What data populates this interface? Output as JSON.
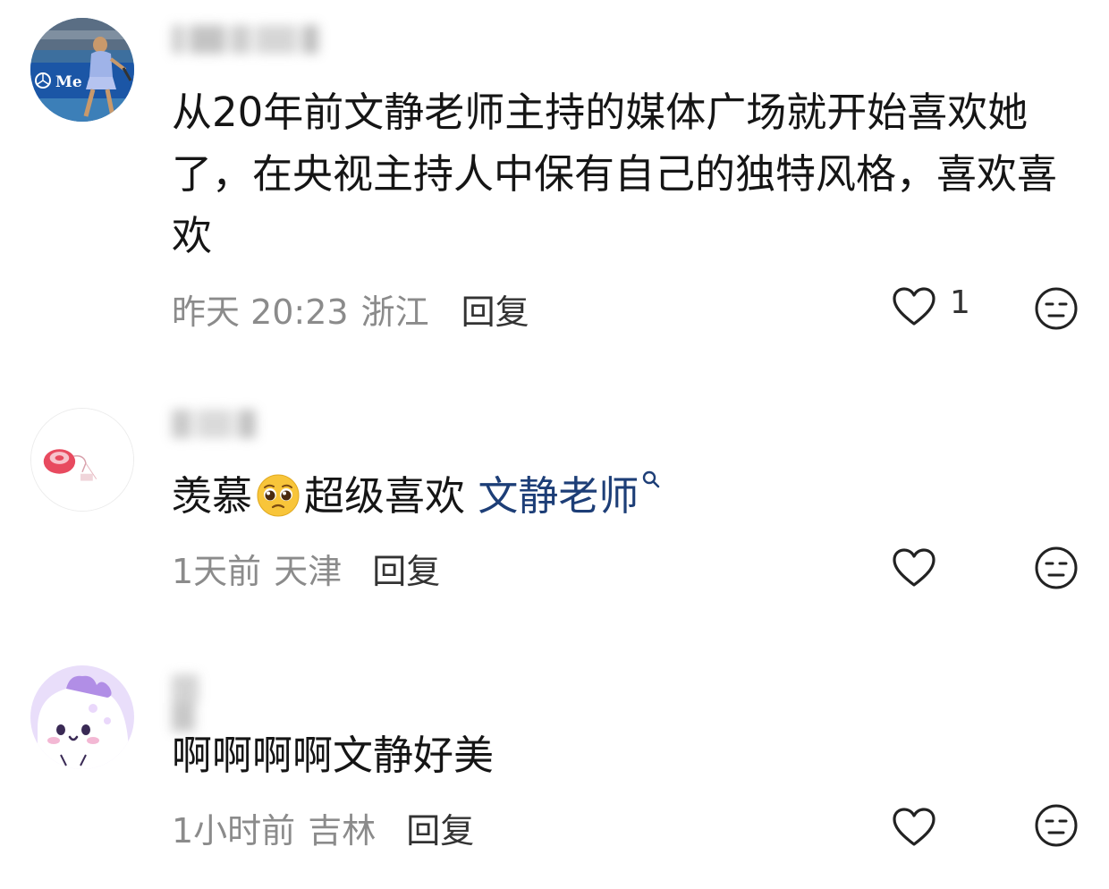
{
  "comments": [
    {
      "username": "",
      "text": "从20年前文静老师主持的媒体广场就开始喜欢她了，在央视主持人中保有自己的独特风格，喜欢喜欢",
      "time": "昨天 20:23",
      "location": "浙江",
      "reply_label": "回复",
      "like_count": "1",
      "avatar_icon": "tennis-player-photo",
      "avatar_logo_text": "Me  es"
    },
    {
      "username": "",
      "text_before": "羡慕",
      "emoji": "pleading-face-emoji",
      "text_after": "超级喜欢 ",
      "link_text": "文静老师",
      "link_icon": "search-icon",
      "time": "1天前",
      "location": "天津",
      "reply_label": "回复",
      "avatar_icon": "red-item-photo"
    },
    {
      "username": "",
      "text": "啊啊啊啊文静好美",
      "time": "1小时前",
      "location": "吉林",
      "reply_label": "回复",
      "avatar_icon": "purple-cartoon-avatar"
    }
  ],
  "colors": {
    "text": "#151515",
    "meta": "#8b8b8b",
    "link": "#1d3e77",
    "icon": "#222222"
  }
}
